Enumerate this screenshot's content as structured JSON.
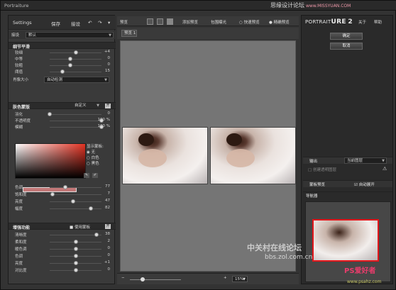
{
  "window": {
    "title": "Portraiture",
    "watermark_site": "思缘设计论坛",
    "watermark_url": "www.MISSYUAN.COM"
  },
  "left": {
    "toolbar": {
      "title": "Settings",
      "save": "保存",
      "restore": "接设"
    },
    "preset": {
      "label": "接设",
      "value": "默认"
    },
    "detail": {
      "title": "细节平滑",
      "sliders": [
        {
          "label": "较细",
          "value": "+4",
          "pos": 0.5
        },
        {
          "label": "中等",
          "value": "0",
          "pos": 0.4
        },
        {
          "label": "较粗",
          "value": "0",
          "pos": 0.4
        },
        {
          "label": "阈值",
          "value": "15",
          "pos": 0.25
        }
      ],
      "size_label": "肖像大小",
      "size_value": "自动检测"
    },
    "mask": {
      "title": "肤色蒙版",
      "mode": "自定义",
      "btn": "开",
      "sliders": [
        {
          "label": "羽化",
          "value": "0",
          "pos": 0.0
        },
        {
          "label": "不透明度",
          "value": "100 %",
          "pos": 1.0
        },
        {
          "label": "模糊",
          "value": "100 %",
          "pos": 1.0
        }
      ],
      "display_label": "显示蒙板:",
      "options": [
        "无",
        "白色",
        "黑色"
      ],
      "hsl": [
        {
          "label": "色调",
          "value": "77",
          "pos": 0.3
        },
        {
          "label": "饱和度",
          "value": "7",
          "pos": 0.05
        },
        {
          "label": "亮度",
          "value": "47",
          "pos": 0.45
        },
        {
          "label": "幅度",
          "value": "82",
          "pos": 0.8
        }
      ]
    },
    "enhance": {
      "title": "增强功能",
      "toggle": "使用蒙板",
      "btn": "开",
      "sliders": [
        {
          "label": "清晰度",
          "value": "38",
          "pos": 0.9
        },
        {
          "label": "柔和度",
          "value": "2",
          "pos": 0.5
        },
        {
          "label": "暖色调",
          "value": "0",
          "pos": 0.5
        },
        {
          "label": "色调",
          "value": "0",
          "pos": 0.5
        },
        {
          "label": "亮度",
          "value": "+1",
          "pos": 0.5
        },
        {
          "label": "对比度",
          "value": "0",
          "pos": 0.5
        }
      ]
    }
  },
  "center": {
    "toolbar": {
      "preview": "预览",
      "add_preview": "添加预览",
      "before_after": "包围曝光",
      "fast": "快速预览",
      "precise": "精确预览"
    },
    "tab": "预览 1",
    "zoom": {
      "value": "15%",
      "pos": 0.25
    }
  },
  "right": {
    "brand_a": "PORTRAIT",
    "brand_b": "URE",
    "brand_v": "2",
    "about": "关于",
    "help": "帮助",
    "ok": "确定",
    "cancel": "取消",
    "output": {
      "label": "输出",
      "value": "当前图层",
      "checkbox": "创建透明图层"
    },
    "mask_preview": {
      "label": "蒙板预览",
      "auto": "自动展开"
    },
    "navigator": "导航器"
  },
  "watermarks": {
    "zol": "中关村在线论坛",
    "zol_url": "bbs.zol.com.cn",
    "ps": "PS爱好者",
    "ps_url": "www.psahz.com"
  }
}
